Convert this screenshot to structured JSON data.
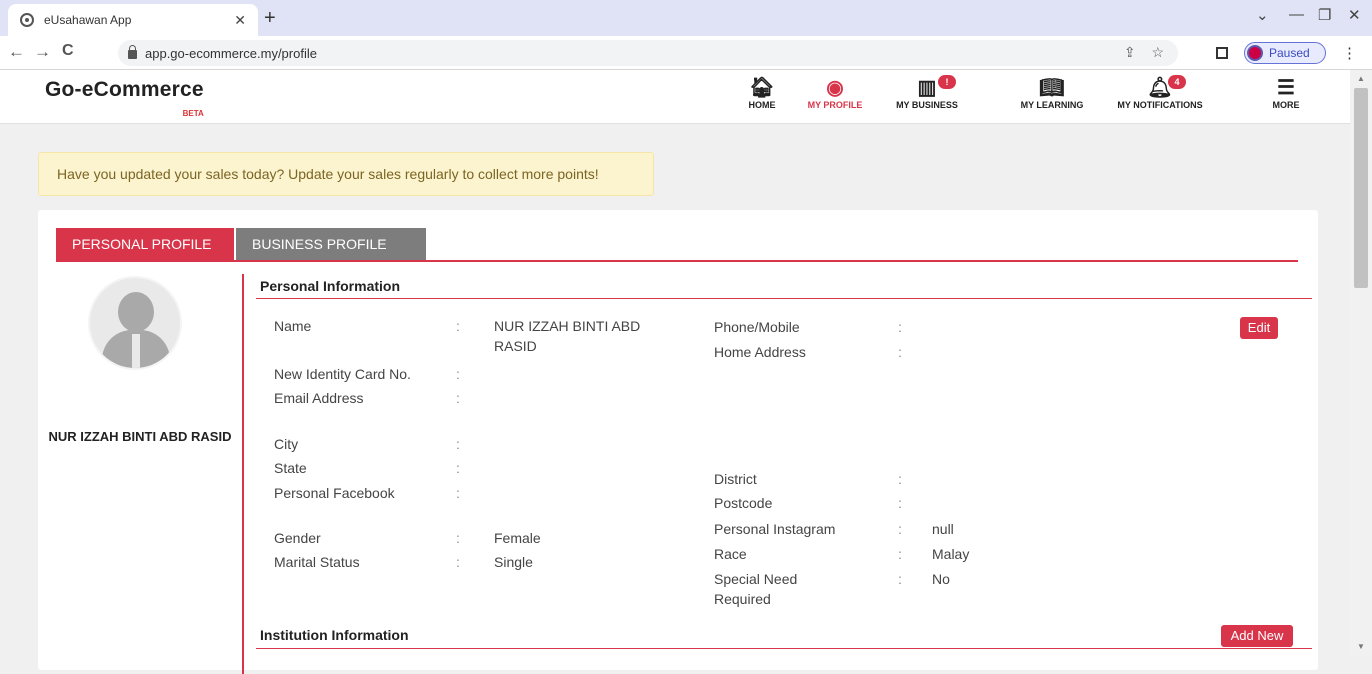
{
  "browser": {
    "tab_title": "eUsahawan App",
    "url": "app.go-ecommerce.my/profile",
    "profile_status": "Paused"
  },
  "site": {
    "logo": "Go-eCommerce",
    "logo_badge": "BETA",
    "nav": {
      "home": "HOME",
      "profile": "MY PROFILE",
      "business": "MY BUSINESS",
      "learning": "MY LEARNING",
      "notifications": "MY NOTIFICATIONS",
      "more": "MORE"
    },
    "notifications_count": "4",
    "accent": "#d8354a"
  },
  "alert": "Have you updated your sales today? Update your sales regularly to collect more points!",
  "tabs": {
    "personal": "PERSONAL PROFILE",
    "business": "BUSINESS PROFILE"
  },
  "profile": {
    "display_name": "NUR IZZAH BINTI ABD RASID"
  },
  "personal_info": {
    "title": "Personal Information",
    "edit_label": "Edit",
    "separator": ":",
    "left": {
      "name_label": "Name",
      "name_value": "NUR IZZAH BINTI ABD RASID",
      "ic_label": "New Identity Card No.",
      "email_label": "Email Address",
      "city_label": "City",
      "state_label": "State",
      "facebook_label": "Personal Facebook",
      "gender_label": "Gender",
      "gender_value": "Female",
      "marital_label": "Marital Status",
      "marital_value": "Single"
    },
    "right": {
      "phone_label": "Phone/Mobile",
      "address_label": "Home Address",
      "district_label": "District",
      "postcode_label": "Postcode",
      "instagram_label": "Personal Instagram",
      "instagram_value": "null",
      "race_label": "Race",
      "race_value": "Malay",
      "special_label": "Special Need Required",
      "special_value": "No"
    }
  },
  "institution_info": {
    "title": "Institution Information",
    "add_label": "Add New"
  }
}
